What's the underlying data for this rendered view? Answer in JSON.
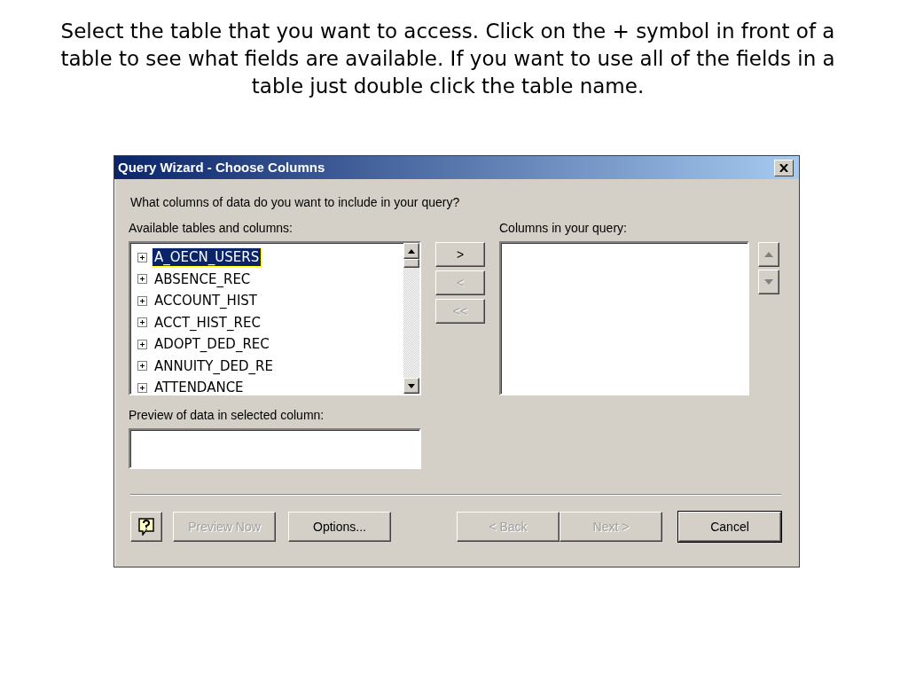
{
  "caption": "Select the table that you want to access. Click on the + symbol in front of a table to see what fields are available. If you want to use all of the fields in a table just double click the table name.",
  "window": {
    "title": "Query Wizard - Choose Columns"
  },
  "question": "What columns of data do you want to include in your query?",
  "available": {
    "label": "Available tables and columns:",
    "tables": [
      {
        "name": "A_OECN_USERS",
        "selected": true,
        "expanded": false
      },
      {
        "name": "ABSENCE_REC",
        "selected": false,
        "expanded": false
      },
      {
        "name": "ACCOUNT_HIST",
        "selected": false,
        "expanded": false
      },
      {
        "name": "ACCT_HIST_REC",
        "selected": false,
        "expanded": false
      },
      {
        "name": "ADOPT_DED_REC",
        "selected": false,
        "expanded": false
      },
      {
        "name": "ANNUITY_DED_RE",
        "selected": false,
        "expanded": false
      },
      {
        "name": "ATTENDANCE",
        "selected": false,
        "expanded": false
      }
    ]
  },
  "move_buttons": [
    {
      "label": ">",
      "disabled": false
    },
    {
      "label": "<",
      "disabled": true
    },
    {
      "label": "<<",
      "disabled": true
    }
  ],
  "query_columns": {
    "label": "Columns in your query:"
  },
  "order_buttons": [
    {
      "kind": "up",
      "disabled": true
    },
    {
      "kind": "down",
      "disabled": true
    }
  ],
  "preview": {
    "label": "Preview of data in selected column:"
  },
  "footer": {
    "left": [
      {
        "label": "Preview Now",
        "disabled": true,
        "default": false
      },
      {
        "label": "Options...",
        "disabled": false,
        "default": false
      }
    ],
    "right": [
      {
        "label": "< Back",
        "disabled": true,
        "default": false
      },
      {
        "label": "Next >",
        "disabled": true,
        "default": false
      },
      {
        "label": "Cancel",
        "disabled": false,
        "default": true
      }
    ]
  }
}
